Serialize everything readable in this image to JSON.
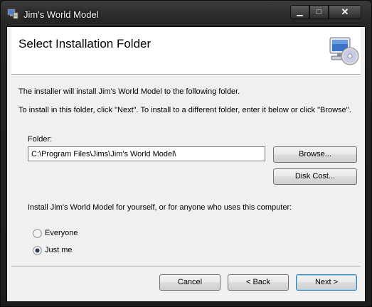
{
  "window": {
    "title": "Jim's World Model",
    "minimize_glyph": "▁",
    "maximize_glyph": "□",
    "close_glyph": "✕"
  },
  "header": {
    "title": "Select Installation Folder",
    "icon": "computer-disc-icon"
  },
  "body": {
    "line1": "The installer will install Jim's World Model to the following folder.",
    "line2": "To install in this folder, click \"Next\". To install to a different folder, enter it below or click \"Browse\"."
  },
  "folder": {
    "label": "Folder:",
    "value": "C:\\Program Files\\Jims\\Jim's World Model\\",
    "browse_label": "Browse...",
    "disk_cost_label": "Disk Cost..."
  },
  "scope": {
    "prompt": "Install Jim's World Model for yourself, or for anyone who uses this computer:",
    "options": [
      {
        "label": "Everyone",
        "selected": false
      },
      {
        "label": "Just me",
        "selected": true
      }
    ]
  },
  "footer": {
    "cancel_label": "Cancel",
    "back_label": "< Back",
    "next_label": "Next >"
  }
}
